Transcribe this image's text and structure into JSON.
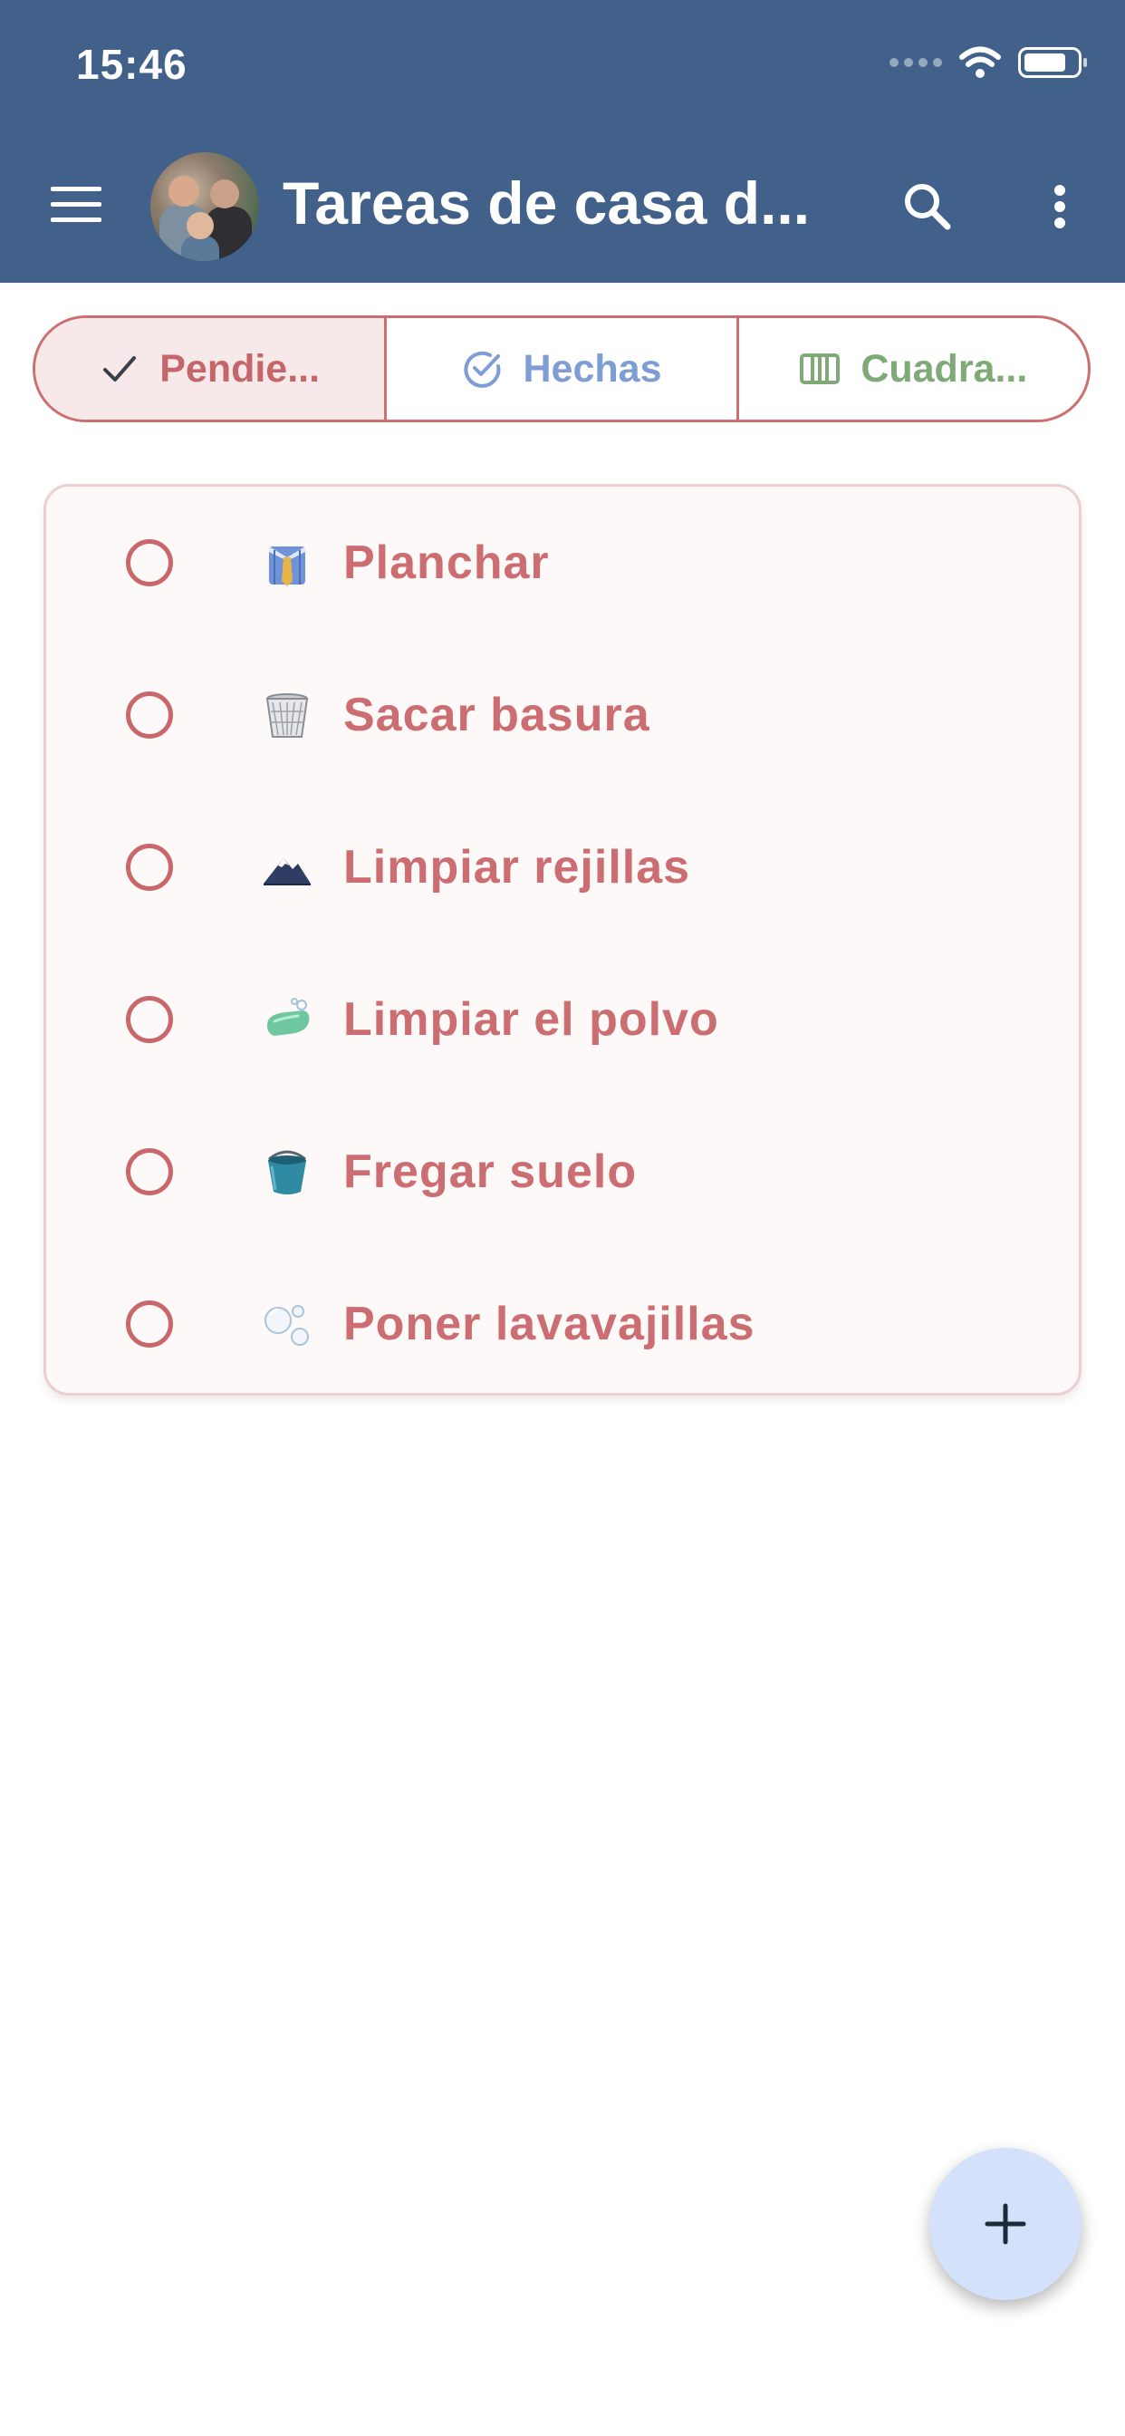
{
  "status_bar": {
    "time": "15:46",
    "icons": [
      "signal-dots-icon",
      "wifi-icon",
      "battery-icon"
    ]
  },
  "app_bar": {
    "title": "Tareas de casa d...",
    "icons": [
      "menu-icon",
      "avatar",
      "search-icon",
      "more-vertical-icon"
    ],
    "background_color": "#42618a"
  },
  "segments": [
    {
      "label": "Pendie...",
      "icon": "check-icon",
      "selected": true,
      "color": "#c4666a"
    },
    {
      "label": "Hechas",
      "icon": "check-circle-icon",
      "selected": false,
      "color": "#7d9dd4"
    },
    {
      "label": "Cuadra...",
      "icon": "grid-columns-icon",
      "selected": false,
      "color": "#7faa78"
    }
  ],
  "tasks": [
    {
      "label": "Planchar",
      "icon": "shirt-tie-icon"
    },
    {
      "label": "Sacar basura",
      "icon": "wastebasket-icon"
    },
    {
      "label": "Limpiar rejillas",
      "icon": "mountain-icon"
    },
    {
      "label": "Limpiar el polvo",
      "icon": "soap-icon"
    },
    {
      "label": "Fregar suelo",
      "icon": "bucket-icon"
    },
    {
      "label": "Poner lavavajillas",
      "icon": "bubbles-icon"
    }
  ],
  "fab": {
    "icon": "plus-icon"
  },
  "colors": {
    "accent": "#cc6d71",
    "card_bg": "#fcf9f8",
    "fab_bg": "#d4e1fa"
  }
}
